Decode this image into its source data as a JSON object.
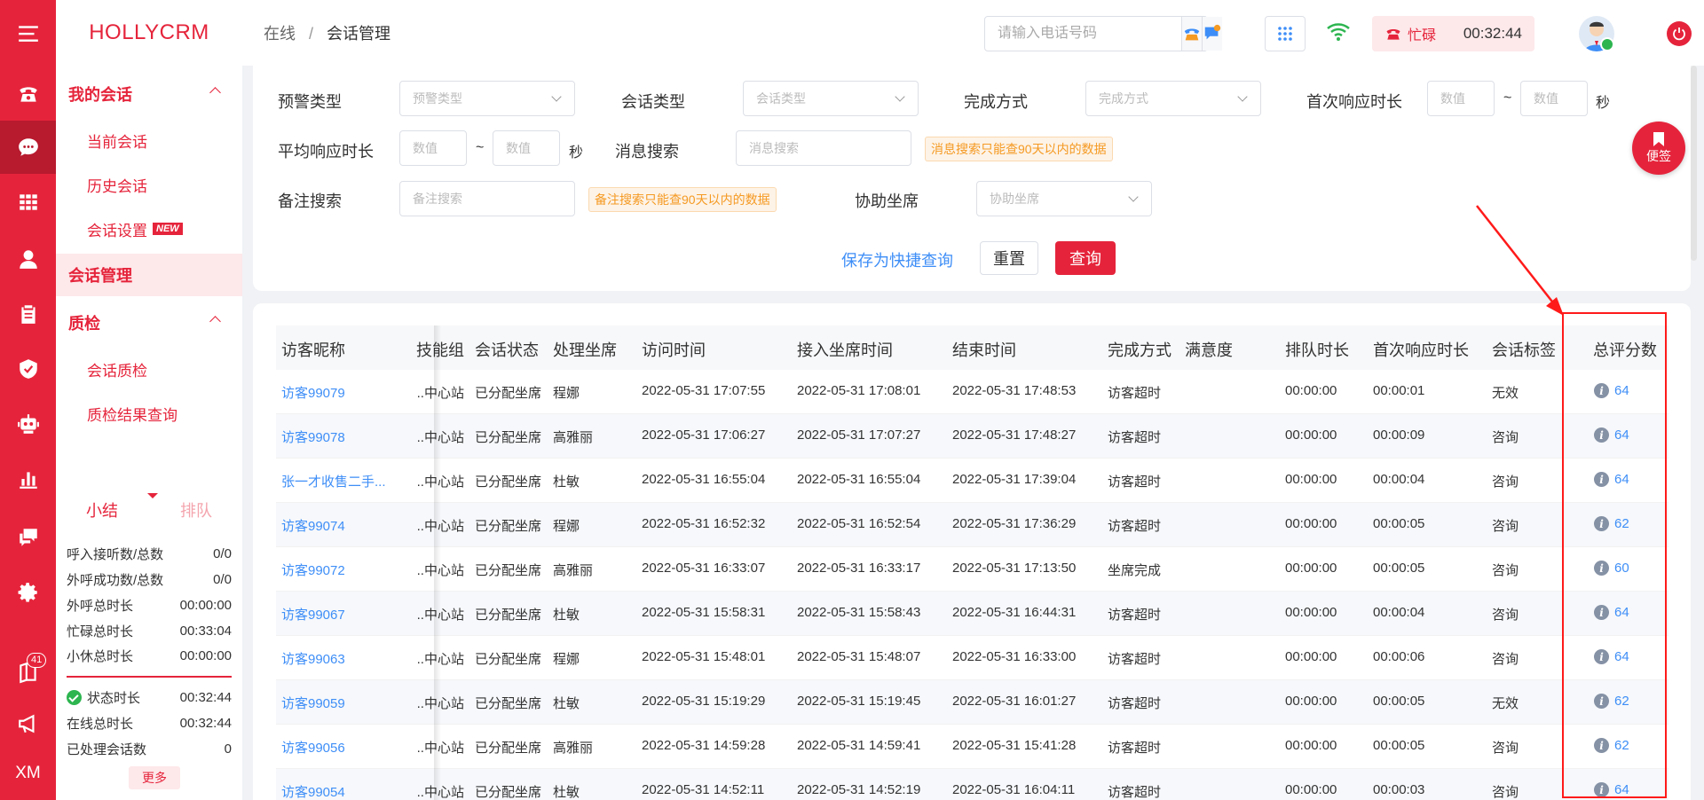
{
  "app": {
    "logo": "HOLLYCRM"
  },
  "rail": {
    "badge": "41",
    "footer": "XM"
  },
  "nav": {
    "group_mine": "我的会话",
    "item_current": "当前会话",
    "item_history": "历史会话",
    "item_settings": "会话设置",
    "badge_new": "NEW",
    "group_manage": "会话管理",
    "group_qc": "质检",
    "item_qc": "会话质检",
    "item_qc_result": "质检结果查询"
  },
  "summary": {
    "tab_summary": "小结",
    "tab_queue": "排队",
    "rows": [
      {
        "label": "呼入接听数/总数",
        "value": "0/0"
      },
      {
        "label": "外呼成功数/总数",
        "value": "0/0"
      },
      {
        "label": "外呼总时长",
        "value": "00:00:00"
      },
      {
        "label": "忙碌总时长",
        "value": "00:33:04"
      },
      {
        "label": "小休总时长",
        "value": "00:00:00"
      }
    ],
    "status": {
      "label": "状态时长",
      "value": "00:32:44"
    },
    "online": {
      "label": "在线总时长",
      "value": "00:32:44"
    },
    "handled": {
      "label": "已处理会话数",
      "value": "0"
    },
    "more": "更多"
  },
  "header": {
    "crumb_root": "在线",
    "crumb_sep": "/",
    "crumb_current": "会话管理",
    "phone_placeholder": "请输入电话号码",
    "busy_label": "忙碌",
    "busy_time": "00:32:44"
  },
  "filters": {
    "warn_type_label": "预警类型",
    "warn_type_ph": "预警类型",
    "session_type_label": "会话类型",
    "session_type_ph": "会话类型",
    "finish_label": "完成方式",
    "finish_ph": "完成方式",
    "first_resp_label": "首次响应时长",
    "num_ph": "数值",
    "tilde": "~",
    "sec": "秒",
    "avg_resp_label": "平均响应时长",
    "msg_search_label": "消息搜索",
    "msg_search_ph": "消息搜索",
    "msg_hint": "消息搜索只能查90天以内的数据",
    "remark_label": "备注搜索",
    "remark_ph": "备注搜索",
    "remark_hint": "备注搜索只能查90天以内的数据",
    "assist_label": "协助坐席",
    "assist_ph": "协助坐席",
    "save_quick": "保存为快捷查询",
    "reset": "重置",
    "query": "查询"
  },
  "note": {
    "label": "便签"
  },
  "table": {
    "headers": [
      "访客昵称",
      "技能组",
      "会话状态",
      "处理坐席",
      "访问时间",
      "接入坐席时间",
      "结束时间",
      "完成方式",
      "满意度",
      "排队时长",
      "首次响应时长",
      "会话标签",
      "总评分数"
    ],
    "rows": [
      {
        "name": "访客99079",
        "group": "中心站...",
        "status": "已分配坐席",
        "agent": "程娜",
        "visit": "2022-05-31 17:07:55",
        "join": "2022-05-31 17:08:01",
        "end": "2022-05-31 17:48:53",
        "finish": "访客超时",
        "sat": "",
        "queue": "00:00:00",
        "first": "00:00:01",
        "tag": "无效",
        "score": "64"
      },
      {
        "name": "访客99078",
        "group": "中心站...",
        "status": "已分配坐席",
        "agent": "高雅丽",
        "visit": "2022-05-31 17:06:27",
        "join": "2022-05-31 17:07:27",
        "end": "2022-05-31 17:48:27",
        "finish": "访客超时",
        "sat": "",
        "queue": "00:00:00",
        "first": "00:00:09",
        "tag": "咨询",
        "score": "64"
      },
      {
        "name": "张一才收售二手...",
        "group": "中心站...",
        "status": "已分配坐席",
        "agent": "杜敏",
        "visit": "2022-05-31 16:55:04",
        "join": "2022-05-31 16:55:04",
        "end": "2022-05-31 17:39:04",
        "finish": "访客超时",
        "sat": "",
        "queue": "00:00:00",
        "first": "00:00:04",
        "tag": "咨询",
        "score": "64"
      },
      {
        "name": "访客99074",
        "group": "中心站...",
        "status": "已分配坐席",
        "agent": "程娜",
        "visit": "2022-05-31 16:52:32",
        "join": "2022-05-31 16:52:54",
        "end": "2022-05-31 17:36:29",
        "finish": "访客超时",
        "sat": "",
        "queue": "00:00:00",
        "first": "00:00:05",
        "tag": "咨询",
        "score": "62"
      },
      {
        "name": "访客99072",
        "group": "中心站...",
        "status": "已分配坐席",
        "agent": "高雅丽",
        "visit": "2022-05-31 16:33:07",
        "join": "2022-05-31 16:33:17",
        "end": "2022-05-31 17:13:50",
        "finish": "坐席完成",
        "sat": "",
        "queue": "00:00:00",
        "first": "00:00:05",
        "tag": "咨询",
        "score": "60"
      },
      {
        "name": "访客99067",
        "group": "中心站...",
        "status": "已分配坐席",
        "agent": "杜敏",
        "visit": "2022-05-31 15:58:31",
        "join": "2022-05-31 15:58:43",
        "end": "2022-05-31 16:44:31",
        "finish": "访客超时",
        "sat": "",
        "queue": "00:00:00",
        "first": "00:00:04",
        "tag": "咨询",
        "score": "64"
      },
      {
        "name": "访客99063",
        "group": "中心站...",
        "status": "已分配坐席",
        "agent": "程娜",
        "visit": "2022-05-31 15:48:01",
        "join": "2022-05-31 15:48:07",
        "end": "2022-05-31 16:33:00",
        "finish": "访客超时",
        "sat": "",
        "queue": "00:00:00",
        "first": "00:00:06",
        "tag": "咨询",
        "score": "64"
      },
      {
        "name": "访客99059",
        "group": "中心站...",
        "status": "已分配坐席",
        "agent": "杜敏",
        "visit": "2022-05-31 15:19:29",
        "join": "2022-05-31 15:19:45",
        "end": "2022-05-31 16:01:27",
        "finish": "访客超时",
        "sat": "",
        "queue": "00:00:00",
        "first": "00:00:05",
        "tag": "无效",
        "score": "62"
      },
      {
        "name": "访客99056",
        "group": "中心站...",
        "status": "已分配坐席",
        "agent": "高雅丽",
        "visit": "2022-05-31 14:59:28",
        "join": "2022-05-31 14:59:41",
        "end": "2022-05-31 15:41:28",
        "finish": "访客超时",
        "sat": "",
        "queue": "00:00:00",
        "first": "00:00:05",
        "tag": "咨询",
        "score": "62"
      },
      {
        "name": "访客99054",
        "group": "中心站...",
        "status": "已分配坐席",
        "agent": "杜敏",
        "visit": "2022-05-31 14:52:11",
        "join": "2022-05-31 14:52:19",
        "end": "2022-05-31 16:04:11",
        "finish": "访客超时",
        "sat": "",
        "queue": "00:00:00",
        "first": "00:00:03",
        "tag": "咨询",
        "score": "64"
      }
    ]
  },
  "colors": {
    "brand": "#e5243b",
    "link": "#3e8ef7",
    "hint": "#f59a23",
    "annotation": "#ff1a1a"
  }
}
